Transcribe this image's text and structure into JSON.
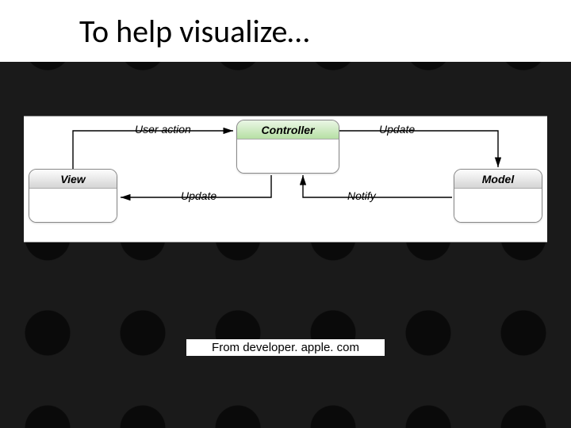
{
  "title": "To help visualize…",
  "caption": "From developer. apple. com",
  "nodes": {
    "view": "View",
    "controller": "Controller",
    "model": "Model"
  },
  "edges": {
    "user_action": "User action",
    "update_top": "Update",
    "update_bottom": "Update",
    "notify": "Notify"
  }
}
